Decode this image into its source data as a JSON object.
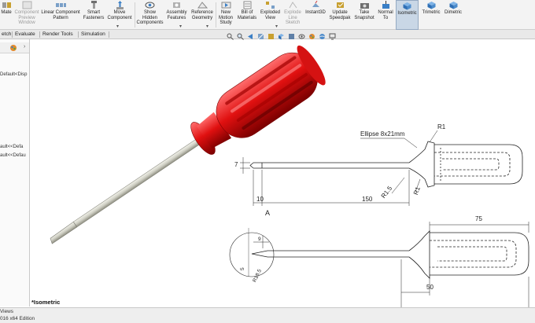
{
  "ribbon": {
    "mate_label": "Mate",
    "component_preview_label": "Component\nPreview\nWindow",
    "linear_pattern_label": "Linear Component\nPattern",
    "smart_fasteners_label": "Smart\nFasteners",
    "move_component_label": "Move\nComponent",
    "show_hidden_label": "Show\nHidden\nComponents",
    "assembly_features_label": "Assembly\nFeatures",
    "reference_geometry_label": "Reference\nGeometry",
    "new_motion_study_label": "New\nMotion\nStudy",
    "bill_of_materials_label": "Bill of\nMaterials",
    "exploded_view_label": "Exploded\nView",
    "explode_line_sketch_label": "Explode\nLine\nSketch",
    "instant3d_label": "Instant3D",
    "update_speedpak_label": "Update\nSpeedpak",
    "take_snapshot_label": "Take\nSnapshot",
    "normal_to_label": "Normal\nTo",
    "isometric_label": "Isometric",
    "trimetric_label": "Trimetric",
    "dimetric_label": "Dimetric"
  },
  "tabs": {
    "sketch": "etch",
    "evaluate": "Evaluate",
    "render_tools": "Render Tools",
    "simulation": "Simulation"
  },
  "tree": {
    "top_item": "Default<Disp",
    "item1": "ault<<Defa",
    "item2": "ault<<Defau"
  },
  "viewport": {
    "view_name": "*Isometric"
  },
  "status": {
    "tab_label": "Views",
    "edition": "016 x64 Edition"
  },
  "drawing": {
    "ellipse_label": "Ellipse 8x21mm",
    "r1_top": "R1",
    "r1_bottom": "R1",
    "r1_5": "R1.5",
    "dim_7": "7",
    "dim_10": "10",
    "dim_150": "150",
    "detail_letter": "A",
    "dim_9": "9",
    "dim_5": "5",
    "r18_5": "R18.5",
    "dim_75": "75",
    "dim_50": "50",
    "dim_100": "100"
  },
  "colors": {
    "handle_red": "#e01010",
    "handle_dark": "#8e0000",
    "shaft": "#cfcfc4",
    "active_button": "#c9d7e6",
    "accent_blue": "#2f6fb5"
  }
}
